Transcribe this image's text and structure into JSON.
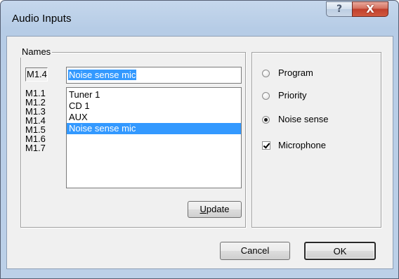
{
  "window": {
    "title": "Audio Inputs",
    "help_glyph": "?",
    "close_glyph": "X"
  },
  "names": {
    "legend": "Names",
    "current_code": "M1.4",
    "current_name": "Noise sense mic",
    "codes": [
      "M1.1",
      "M1.2",
      "M1.3",
      "M1.4",
      "M1.5",
      "M1.6",
      "M1.7"
    ],
    "items": [
      "Tuner 1",
      "CD 1",
      "AUX",
      "Noise sense mic"
    ],
    "selected_index": 3,
    "update_label_accel": "U",
    "update_label_rest": "pdate"
  },
  "options": {
    "radios": [
      {
        "label": "Program",
        "checked": false
      },
      {
        "label": "Priority",
        "checked": false
      },
      {
        "label": "Noise sense",
        "checked": true
      }
    ],
    "checkbox": {
      "label": "Microphone",
      "checked": true
    }
  },
  "footer": {
    "cancel_label": "Cancel",
    "ok_label": "OK"
  },
  "colors": {
    "selection": "#3399ff",
    "dialog_face": "#f0f0f0",
    "close_button": "#c7442e"
  }
}
